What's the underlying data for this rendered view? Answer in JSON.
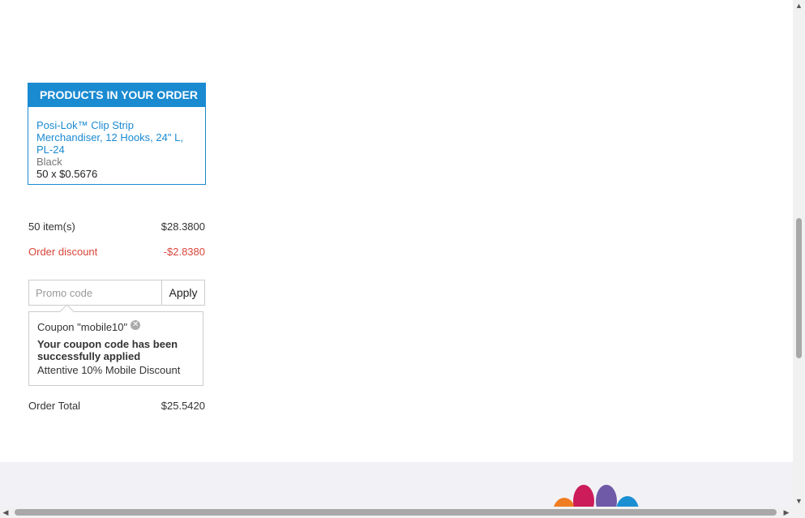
{
  "products": {
    "header": "PRODUCTS IN YOUR ORDER",
    "items": [
      {
        "name": "Posi-Lok™ Clip Strip Merchandiser, 12 Hooks, 24\" L, PL-24",
        "variant": "Black",
        "quantity_price": "50 x $0.5676"
      }
    ]
  },
  "summary": {
    "items_label": "50 item(s)",
    "items_value": "$28.3800",
    "discount_label": "Order discount",
    "discount_value": "-$2.8380",
    "total_label": "Order Total",
    "total_value": "$25.5420"
  },
  "promo": {
    "placeholder": "Promo code",
    "value": "",
    "apply_label": "Apply"
  },
  "coupon": {
    "code_text": "Coupon \"mobile10\"",
    "success_message": "Your coupon code has been successfully applied",
    "description": "Attentive 10% Mobile Discount"
  },
  "icons": {
    "coupon_remove": "close-circle-icon",
    "scroll_up": "arrow-up-icon",
    "scroll_down": "arrow-down-icon",
    "scroll_left": "arrow-left-icon",
    "scroll_right": "arrow-right-icon"
  },
  "colors": {
    "accent": "#1a8ad1",
    "discount": "#d9453a",
    "footer_bg": "#f2f2f6"
  }
}
